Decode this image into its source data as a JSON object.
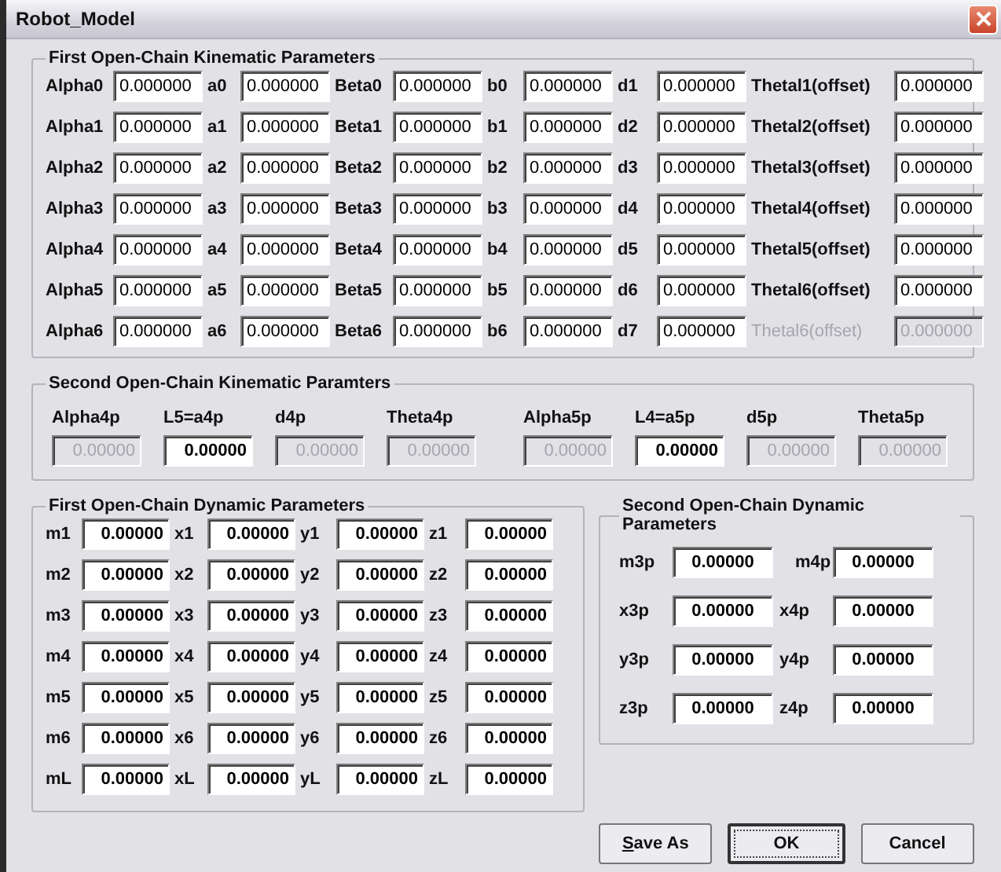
{
  "window": {
    "title": "Robot_Model"
  },
  "first_kinematic": {
    "title": "First Open-Chain Kinematic Parameters",
    "rows": [
      {
        "fields": [
          {
            "label": "Alpha0",
            "value": "0.000000",
            "disabled": false
          },
          {
            "label": "a0",
            "value": "0.000000",
            "disabled": false
          },
          {
            "label": "Beta0",
            "value": "0.000000",
            "disabled": false
          },
          {
            "label": "b0",
            "value": "0.000000",
            "disabled": false
          },
          {
            "label": "d1",
            "value": "0.000000",
            "disabled": false
          },
          {
            "label": "Thetal1(offset)",
            "value": "0.000000",
            "disabled": false
          }
        ]
      },
      {
        "fields": [
          {
            "label": "Alpha1",
            "value": "0.000000",
            "disabled": false
          },
          {
            "label": "a1",
            "value": "0.000000",
            "disabled": false
          },
          {
            "label": "Beta1",
            "value": "0.000000",
            "disabled": false
          },
          {
            "label": "b1",
            "value": "0.000000",
            "disabled": false
          },
          {
            "label": "d2",
            "value": "0.000000",
            "disabled": false
          },
          {
            "label": "Thetal2(offset)",
            "value": "0.000000",
            "disabled": false
          }
        ]
      },
      {
        "fields": [
          {
            "label": "Alpha2",
            "value": "0.000000",
            "disabled": false
          },
          {
            "label": "a2",
            "value": "0.000000",
            "disabled": false
          },
          {
            "label": "Beta2",
            "value": "0.000000",
            "disabled": false
          },
          {
            "label": "b2",
            "value": "0.000000",
            "disabled": false
          },
          {
            "label": "d3",
            "value": "0.000000",
            "disabled": false
          },
          {
            "label": "Thetal3(offset)",
            "value": "0.000000",
            "disabled": false
          }
        ]
      },
      {
        "fields": [
          {
            "label": "Alpha3",
            "value": "0.000000",
            "disabled": false
          },
          {
            "label": "a3",
            "value": "0.000000",
            "disabled": false
          },
          {
            "label": "Beta3",
            "value": "0.000000",
            "disabled": false
          },
          {
            "label": "b3",
            "value": "0.000000",
            "disabled": false
          },
          {
            "label": "d4",
            "value": "0.000000",
            "disabled": false
          },
          {
            "label": "Thetal4(offset)",
            "value": "0.000000",
            "disabled": false
          }
        ]
      },
      {
        "fields": [
          {
            "label": "Alpha4",
            "value": "0.000000",
            "disabled": false
          },
          {
            "label": "a4",
            "value": "0.000000",
            "disabled": false
          },
          {
            "label": "Beta4",
            "value": "0.000000",
            "disabled": false
          },
          {
            "label": "b4",
            "value": "0.000000",
            "disabled": false
          },
          {
            "label": "d5",
            "value": "0.000000",
            "disabled": false
          },
          {
            "label": "Thetal5(offset)",
            "value": "0.000000",
            "disabled": false
          }
        ]
      },
      {
        "fields": [
          {
            "label": "Alpha5",
            "value": "0.000000",
            "disabled": false
          },
          {
            "label": "a5",
            "value": "0.000000",
            "disabled": false
          },
          {
            "label": "Beta5",
            "value": "0.000000",
            "disabled": false
          },
          {
            "label": "b5",
            "value": "0.000000",
            "disabled": false
          },
          {
            "label": "d6",
            "value": "0.000000",
            "disabled": false
          },
          {
            "label": "Thetal6(offset)",
            "value": "0.000000",
            "disabled": false
          }
        ]
      },
      {
        "fields": [
          {
            "label": "Alpha6",
            "value": "0.000000",
            "disabled": false
          },
          {
            "label": "a6",
            "value": "0.000000",
            "disabled": false
          },
          {
            "label": "Beta6",
            "value": "0.000000",
            "disabled": false
          },
          {
            "label": "b6",
            "value": "0.000000",
            "disabled": false
          },
          {
            "label": "d7",
            "value": "0.000000",
            "disabled": false
          },
          {
            "label": "Thetal6(offset)",
            "value": "0.000000",
            "disabled": true
          }
        ]
      }
    ]
  },
  "second_kinematic": {
    "title": "Second Open-Chain Kinematic Paramters",
    "fields": [
      {
        "label": "Alpha4p",
        "value": "0.00000",
        "disabled": true
      },
      {
        "label": "L5=a4p",
        "value": "0.00000",
        "disabled": false
      },
      {
        "label": "d4p",
        "value": "0.00000",
        "disabled": true
      },
      {
        "label": "Theta4p",
        "value": "0.00000",
        "disabled": true
      },
      {
        "label": "Alpha5p",
        "value": "0.00000",
        "disabled": true
      },
      {
        "label": "L4=a5p",
        "value": "0.00000",
        "disabled": false
      },
      {
        "label": "d5p",
        "value": "0.00000",
        "disabled": true
      },
      {
        "label": "Theta5p",
        "value": "0.00000",
        "disabled": true
      }
    ]
  },
  "first_dynamic": {
    "title": "First Open-Chain Dynamic Parameters",
    "rows": [
      {
        "fields": [
          {
            "label": "m1",
            "value": "0.00000"
          },
          {
            "label": "x1",
            "value": "0.00000"
          },
          {
            "label": "y1",
            "value": "0.00000"
          },
          {
            "label": "z1",
            "value": "0.00000"
          }
        ]
      },
      {
        "fields": [
          {
            "label": "m2",
            "value": "0.00000"
          },
          {
            "label": "x2",
            "value": "0.00000"
          },
          {
            "label": "y2",
            "value": "0.00000"
          },
          {
            "label": "z2",
            "value": "0.00000"
          }
        ]
      },
      {
        "fields": [
          {
            "label": "m3",
            "value": "0.00000"
          },
          {
            "label": "x3",
            "value": "0.00000"
          },
          {
            "label": "y3",
            "value": "0.00000"
          },
          {
            "label": "z3",
            "value": "0.00000"
          }
        ]
      },
      {
        "fields": [
          {
            "label": "m4",
            "value": "0.00000"
          },
          {
            "label": "x4",
            "value": "0.00000"
          },
          {
            "label": "y4",
            "value": "0.00000"
          },
          {
            "label": "z4",
            "value": "0.00000"
          }
        ]
      },
      {
        "fields": [
          {
            "label": "m5",
            "value": "0.00000"
          },
          {
            "label": "x5",
            "value": "0.00000"
          },
          {
            "label": "y5",
            "value": "0.00000"
          },
          {
            "label": "z5",
            "value": "0.00000"
          }
        ]
      },
      {
        "fields": [
          {
            "label": "m6",
            "value": "0.00000"
          },
          {
            "label": "x6",
            "value": "0.00000"
          },
          {
            "label": "y6",
            "value": "0.00000"
          },
          {
            "label": "z6",
            "value": "0.00000"
          }
        ]
      },
      {
        "fields": [
          {
            "label": "mL",
            "value": "0.00000"
          },
          {
            "label": "xL",
            "value": "0.00000"
          },
          {
            "label": "yL",
            "value": "0.00000"
          },
          {
            "label": "zL",
            "value": "0.00000"
          }
        ]
      }
    ]
  },
  "second_dynamic": {
    "title": "Second Open-Chain Dynamic Parameters",
    "rows": [
      {
        "fields": [
          {
            "label": "m3p",
            "value": "0.00000"
          },
          {
            "label": "m4p",
            "value": "0.00000"
          }
        ]
      },
      {
        "fields": [
          {
            "label": "x3p",
            "value": "0.00000"
          },
          {
            "label": "x4p",
            "value": "0.00000"
          }
        ]
      },
      {
        "fields": [
          {
            "label": "y3p",
            "value": "0.00000"
          },
          {
            "label": "y4p",
            "value": "0.00000"
          }
        ]
      },
      {
        "fields": [
          {
            "label": "z3p",
            "value": "0.00000"
          },
          {
            "label": "z4p",
            "value": "0.00000"
          }
        ]
      }
    ]
  },
  "buttons": [
    {
      "label": "Save As",
      "default": false,
      "underline_first": true
    },
    {
      "label": "OK",
      "default": true,
      "underline_first": false
    },
    {
      "label": "Cancel",
      "default": false,
      "underline_first": false
    }
  ]
}
